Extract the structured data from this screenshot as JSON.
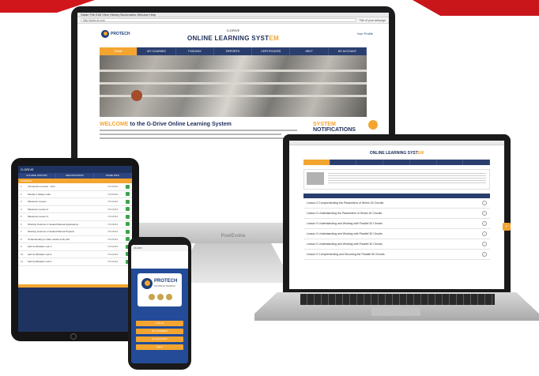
{
  "colors": {
    "navy": "#1c2d5a",
    "orange": "#f3a530",
    "brand_red": "#d0161b"
  },
  "desktop": {
    "browser_menu": "Safari  File  Edit  View  History  Bookmarks  Window  Help",
    "url": "http://www.ot.com",
    "tab_title": "Title of your webpage",
    "logo_text": "PROTECH",
    "site_subtitle": "G-DRIVE",
    "site_title_main": "ONLINE LEARNING SYST",
    "site_title_accent": "EM",
    "user_link": "Your Profile",
    "nav": [
      "HOME",
      "MY COURSES",
      "TOOLBOX",
      "REPORTS",
      "CERTIFICATES",
      "HELP",
      "MY ACCOUNT"
    ],
    "welcome_accent": "WELCOME",
    "welcome_rest": " to the G-Drive Online Learning System",
    "notifications_accent": "SYSTEM",
    "notifications_rest": " NOTIFICATIONS",
    "monitor_brand": "PixelEvolve"
  },
  "laptop": {
    "title_main": "ONLINE LEARNING SYST",
    "title_accent": "EM",
    "section_label": "",
    "lessons": [
      "Lesson 0 Comprehending the Parameters of Series 30 Circuits",
      "Lesson 0 Understanding the Parameters of Series 40 Circuits",
      "Lesson 0 Understanding and Working with Parallel 20 Circuits",
      "Lesson 0 Understanding and Working with Parallel 30 Circuits",
      "Lesson 0 Understanding and Working with Parallel 40 Circuits",
      "Lesson 0 Comprehending and Decoding the Parallel 50 Circuits"
    ]
  },
  "tablet": {
    "top_title": "G-DRIVE",
    "tabs": [
      "COURSE HISTORY",
      "REGISTRATION",
      "MORE INFO"
    ],
    "list_header": "LESSONS",
    "rows": [
      {
        "num": "1",
        "label": "Introduction Lesson - Intro",
        "date": "7/21/2016"
      },
      {
        "num": "2",
        "label": "Module 1 Safety Labs",
        "date": "7/21/2016"
      },
      {
        "num": "3",
        "label": "Measures Lesson",
        "date": "7/21/2016"
      },
      {
        "num": "4",
        "label": "Measures Lesson 2",
        "date": "7/21/2016"
      },
      {
        "num": "5",
        "label": "Measures Lesson 3",
        "date": "7/21/2016"
      },
      {
        "num": "6",
        "label": "Working Outcome 1 Sealed Manual Applications",
        "date": "7/21/2016"
      },
      {
        "num": "7",
        "label": "Working Outcome 2 Sealed Manual Projects",
        "date": "7/21/2016"
      },
      {
        "num": "8",
        "label": "Understanding to Safe Labels at the EO",
        "date": "7/21/2016"
      },
      {
        "num": "9",
        "label": "Self Certification Lab 1",
        "date": "7/21/2016"
      },
      {
        "num": "10",
        "label": "Self Certification Lab 2",
        "date": "7/21/2016"
      },
      {
        "num": "11",
        "label": "Self Certification Lab 3",
        "date": "7/21/2016"
      }
    ]
  },
  "phone": {
    "url": "ot.com",
    "logo_text": "PROTECH",
    "logo_sub": "TECHNICAL TRAINING",
    "buttons": [
      "LOG IN",
      "MY COURSES",
      "MY ACCOUNT",
      "HELP"
    ]
  }
}
